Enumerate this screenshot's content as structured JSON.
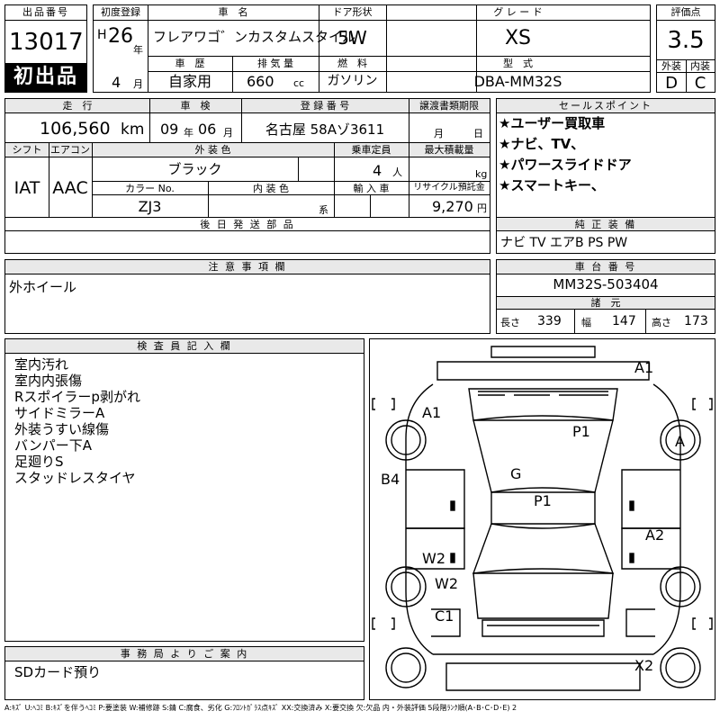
{
  "header": {
    "lot_no_label": "出品番号",
    "lot_no": "13017",
    "first_listing": "初出品",
    "first_reg_label": "初度登録",
    "era": "H",
    "year": "26",
    "year_unit": "年",
    "month": "4",
    "month_unit": "月",
    "car_name_label": "車　名",
    "car_name": "フレアワゴ゛ンカスタムスタイル",
    "history_label": "車　歴",
    "history": "自家用",
    "displacement_label": "排 気 量",
    "displacement": "660",
    "displacement_unit": "cc",
    "door_label": "ドア形状",
    "door": "5W",
    "fuel_label": "燃　料",
    "fuel": "ガソリン",
    "grade_label": "グ レ ー ド",
    "grade": "XS",
    "model_label": "型　式",
    "model": "DBA-MM32S",
    "score_label": "評価点",
    "score": "3.5",
    "ext_label": "外装",
    "ext": "D",
    "int_label": "内装",
    "int": "C"
  },
  "row2": {
    "mileage_label": "走　行",
    "mileage": "106,560",
    "mileage_unit": "km",
    "inspection_label": "車　検",
    "insp_year": "09",
    "insp_year_unit": "年",
    "insp_month": "06",
    "insp_month_unit": "月",
    "plate_label": "登 録 番 号",
    "plate": "名古屋 58Aゾ3611",
    "transfer_label": "譲渡書類期限",
    "transfer_month": "月",
    "transfer_day": "日"
  },
  "row3": {
    "shift_label": "シフト",
    "shift": "IAT",
    "ac_label": "エアコン",
    "ac": "AAC",
    "ext_color_label": "外 装 色",
    "ext_color": "ブラック",
    "capacity_label": "乗車定員",
    "capacity": "4",
    "capacity_unit": "人",
    "max_load_label": "最大積載量",
    "max_load_unit": "kg",
    "color_no_label": "カラー No.",
    "color_no": "ZJ3",
    "int_color_label": "内 装 色",
    "int_color_unit": "系",
    "import_label": "輸 入 車",
    "recycle_label": "リサイクル預託金",
    "recycle": "9,270",
    "recycle_unit": "円"
  },
  "sales_points": {
    "label": "セールスポイント",
    "items": [
      "★ユーザー買取車",
      "★ナビ、TV、",
      "★パワースライドドア",
      "★スマートキー、"
    ]
  },
  "later_parts": {
    "label": "後 日 発 送 部 品"
  },
  "equipment": {
    "label": "純 正 装 備",
    "value": "ナビ TV エアB PS PW"
  },
  "notes": {
    "label": "注 意 事 項 欄",
    "text": "外ホイール"
  },
  "chassis": {
    "label": "車 台 番 号",
    "value": "MM32S-503404"
  },
  "specs": {
    "label": "諸　元",
    "length_label": "長さ",
    "length": "339",
    "width_label": "幅",
    "width": "147",
    "height_label": "高さ",
    "height": "173"
  },
  "inspector": {
    "label": "検 査 員 記 入 欄",
    "items": [
      "室内汚れ",
      "室内内張傷",
      "Rスポイラーp剥がれ",
      "サイドミラーA",
      "外装うすい線傷",
      "バンパー下A",
      "足廻りS",
      "スタッドレスタイヤ"
    ]
  },
  "office": {
    "label": "事 務 局 よ り ご 案 内",
    "text": "SDカード預り"
  },
  "diagram_marks": {
    "a1_top": "A1",
    "a1_left": "A1",
    "p1_hood": "P1",
    "a_wheel": "A",
    "b4": "B4",
    "g": "G",
    "p1_roof": "P1",
    "a2": "A2",
    "w2_a": "W2",
    "w2_b": "W2",
    "c1": "C1",
    "x2": "X2"
  },
  "legend": "A:ｷｽﾞ U:ﾍｺﾐ B:ｷｽﾞを伴うﾍｺﾐ P:要塗装 W:補修跡 S:錆 C:腐食、劣化 G:ﾌﾛﾝﾄｶﾞﾗｽ点ｷｽﾞ XX:交換済み X:要交換 欠:欠品 内・外装評価 5段階ﾗﾝｸ順(A･B･C･D･E) 2"
}
